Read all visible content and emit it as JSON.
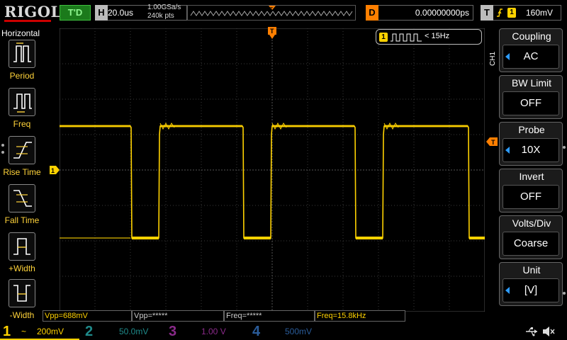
{
  "brand": "RIGOL",
  "top": {
    "run_status": "T'D",
    "timebase_letter": "H",
    "timebase": "20.0us",
    "sample_rate": "1.00GSa/s",
    "memory_depth": "240k pts",
    "delay_letter": "D",
    "delay": "0.00000000ps",
    "trigger_letter": "T",
    "trigger_channel": "1",
    "trigger_level": "160mV"
  },
  "left_menu": {
    "title": "Horizontal",
    "items": [
      {
        "label": "Period",
        "icon": "period-icon"
      },
      {
        "label": "Freq",
        "icon": "freq-icon"
      },
      {
        "label": "Rise Time",
        "icon": "rise-time-icon"
      },
      {
        "label": "Fall Time",
        "icon": "fall-time-icon"
      },
      {
        "label": "+Width",
        "icon": "positive-width-icon"
      },
      {
        "label": "-Width",
        "icon": "negative-width-icon"
      }
    ]
  },
  "right_menu": {
    "channel_tag": "CH1",
    "items": [
      {
        "title": "Coupling",
        "value": "AC"
      },
      {
        "title": "BW Limit",
        "value": "OFF"
      },
      {
        "title": "Probe",
        "value": "10X"
      },
      {
        "title": "Invert",
        "value": "OFF"
      },
      {
        "title": "Volts/Div",
        "value": "Coarse"
      },
      {
        "title": "Unit",
        "value": "[V]"
      }
    ]
  },
  "counter": {
    "channel": "1",
    "text": "< 15Hz"
  },
  "markers": {
    "trigger_pos": "T",
    "ch1_ground": "1",
    "trigger_level": "T"
  },
  "measurements": [
    "Vpp=688mV",
    "Vpp=*****",
    "Freq=*****",
    "Freq=15.8kHz"
  ],
  "channels": [
    {
      "num": "1",
      "coupling_symbol": "~",
      "scale": "200mV",
      "color": "#ffd200",
      "active": true
    },
    {
      "num": "2",
      "coupling_symbol": "",
      "scale": "50.0mV",
      "color": "#1f8a8a",
      "active": false
    },
    {
      "num": "3",
      "coupling_symbol": "",
      "scale": "1.00 V",
      "color": "#8a2a8a",
      "active": false
    },
    {
      "num": "4",
      "coupling_symbol": "",
      "scale": "500mV",
      "color": "#2a5c9a",
      "active": false
    }
  ],
  "colors": {
    "ch1": "#ffd200",
    "trigger": "#ff7f00",
    "menu_label": "#ffd33a",
    "accent_blue": "#2d9cff"
  }
}
